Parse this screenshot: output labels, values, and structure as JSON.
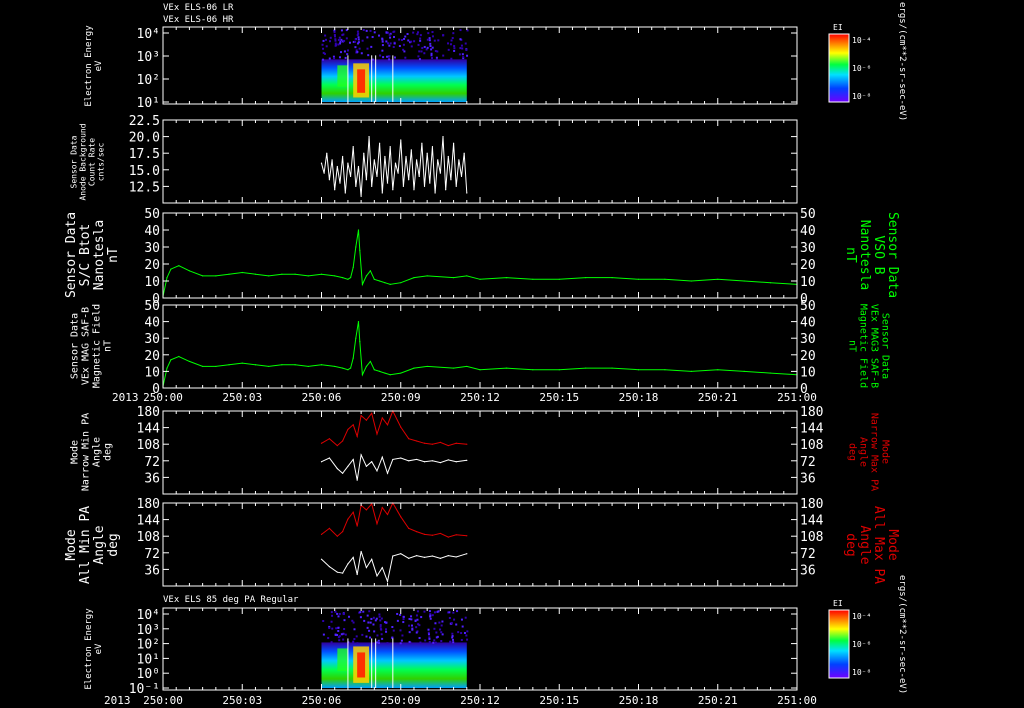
{
  "header": {
    "line1": "VEx ELS-06 LR",
    "line2": "VEx ELS-06 HR",
    "panel7_title": "VEx ELS 85 deg PA Regular"
  },
  "units_right": "ergs/(cm**2-sr-sec-eV)",
  "colorbar": {
    "label": "EI",
    "ticks": [
      "10⁻⁴",
      "10⁻⁶",
      "10⁻⁸"
    ]
  },
  "time_axis": {
    "year": "2013",
    "ticks": [
      "250:00",
      "250:03",
      "250:06",
      "250:09",
      "250:12",
      "250:15",
      "250:18",
      "250:21",
      "251:00"
    ]
  },
  "chart_data": [
    {
      "id": "p1",
      "type": "heatmap",
      "ylabel": [
        "Electron Energy",
        "eV"
      ],
      "yticks": [
        "10⁴",
        "10³",
        "10²",
        "10¹"
      ],
      "x_range": [
        "250:06",
        "250:11"
      ]
    },
    {
      "id": "p2",
      "type": "line",
      "ylabel": [
        "Sensor Data",
        "Anode Background",
        "Count Rate",
        "cnts/sec"
      ],
      "yticks": [
        "22.5",
        "20.0",
        "17.5",
        "15.0",
        "12.5"
      ],
      "ylim": [
        10,
        22.5
      ],
      "series": [
        {
          "color": "#ffffff",
          "x": [
            6.0,
            6.1,
            6.2,
            6.3,
            6.4,
            6.5,
            6.6,
            6.7,
            6.8,
            6.9,
            7.0,
            7.1,
            7.2,
            7.3,
            7.4,
            7.5,
            7.6,
            7.7,
            7.8,
            7.9,
            8.0,
            8.1,
            8.2,
            8.3,
            8.4,
            8.5,
            8.6,
            8.7,
            8.8,
            8.9,
            9.0,
            9.1,
            9.2,
            9.3,
            9.4,
            9.5,
            9.6,
            9.7,
            9.8,
            9.9,
            10.0,
            10.1,
            10.2,
            10.3,
            10.4,
            10.5,
            10.6,
            10.7,
            10.8,
            10.9,
            11.0,
            11.1,
            11.2,
            11.3,
            11.4,
            11.5
          ],
          "y": [
            16.0,
            14.5,
            17.5,
            13.5,
            16.5,
            12.0,
            15.5,
            13.0,
            17.0,
            11.5,
            16.0,
            14.0,
            18.5,
            12.5,
            15.5,
            11.0,
            17.5,
            13.5,
            20.0,
            12.5,
            16.5,
            14.0,
            19.0,
            11.5,
            17.0,
            13.0,
            18.5,
            12.0,
            16.0,
            14.5,
            19.5,
            12.5,
            17.0,
            13.5,
            18.0,
            12.0,
            16.5,
            14.0,
            19.0,
            12.5,
            17.5,
            13.0,
            18.5,
            11.5,
            16.5,
            14.5,
            20.0,
            12.0,
            17.0,
            13.5,
            19.0,
            12.5,
            16.5,
            14.0,
            17.5,
            11.5
          ]
        }
      ]
    },
    {
      "id": "p3",
      "type": "line",
      "ylabel": [
        "Sensor Data",
        "S/C Btot",
        "Nanotesla",
        "nT"
      ],
      "ylabel_right": [
        "Sensor Data",
        "VSO B",
        "Nanotesla",
        "nT"
      ],
      "yticks": [
        "50",
        "40",
        "30",
        "20",
        "10",
        "0"
      ],
      "ylim": [
        0,
        50
      ],
      "series": [
        {
          "color": "#00ff00",
          "x": [
            0.0,
            0.15,
            0.3,
            0.6,
            1.0,
            1.5,
            2.0,
            2.5,
            3.0,
            3.5,
            4.0,
            4.5,
            5.0,
            5.5,
            6.0,
            6.5,
            6.8,
            7.0,
            7.1,
            7.2,
            7.3,
            7.4,
            7.45,
            7.55,
            7.7,
            7.85,
            8.0,
            8.2,
            8.4,
            8.6,
            9.0,
            9.5,
            10.0,
            11.0,
            11.5,
            12.0,
            13.0,
            14.0,
            15.0,
            16.0,
            17.0,
            18.0,
            19.0,
            20.0,
            21.0,
            22.0,
            23.0,
            24.0
          ],
          "y": [
            1,
            12,
            17,
            19,
            16,
            13,
            13,
            14,
            15,
            14,
            13,
            14,
            14,
            13,
            14,
            13,
            12,
            11,
            12,
            18,
            30,
            40,
            28,
            8,
            13,
            16,
            11,
            10,
            9,
            8,
            9,
            12,
            13,
            12,
            13,
            11,
            12,
            11,
            11,
            12,
            12,
            11,
            11,
            10,
            11,
            10,
            9,
            8
          ]
        }
      ]
    },
    {
      "id": "p4",
      "type": "line",
      "ylabel": [
        "Sensor Data",
        "VEx MAG SAF-B",
        "Magnetic Field",
        "nT"
      ],
      "ylabel_right": [
        "Sensor Data",
        "VEx MAG3 SAF-B",
        "Magnetic Field",
        "nT"
      ],
      "yticks": [
        "50",
        "40",
        "30",
        "20",
        "10",
        "0"
      ],
      "ylim": [
        0,
        50
      ],
      "series": [
        {
          "color": "#00ff00",
          "x": [
            0.0,
            0.15,
            0.3,
            0.6,
            1.0,
            1.5,
            2.0,
            2.5,
            3.0,
            3.5,
            4.0,
            4.5,
            5.0,
            5.5,
            6.0,
            6.5,
            6.8,
            7.0,
            7.1,
            7.2,
            7.3,
            7.4,
            7.45,
            7.55,
            7.7,
            7.85,
            8.0,
            8.2,
            8.4,
            8.6,
            9.0,
            9.5,
            10.0,
            11.0,
            11.5,
            12.0,
            13.0,
            14.0,
            15.0,
            16.0,
            17.0,
            18.0,
            19.0,
            20.0,
            21.0,
            22.0,
            23.0,
            24.0
          ],
          "y": [
            1,
            12,
            17,
            19,
            16,
            13,
            13,
            14,
            15,
            14,
            13,
            14,
            14,
            13,
            14,
            13,
            12,
            11,
            12,
            18,
            30,
            40,
            28,
            8,
            13,
            16,
            11,
            10,
            9,
            8,
            9,
            12,
            13,
            12,
            13,
            11,
            12,
            11,
            11,
            12,
            12,
            11,
            11,
            10,
            11,
            10,
            9,
            8
          ]
        }
      ]
    },
    {
      "id": "p5",
      "type": "line",
      "ylabel": [
        "Mode",
        "Narrow Min PA",
        "Angle",
        "deg"
      ],
      "ylabel_right": [
        "Mode",
        "Narrow Max PA",
        "Angle",
        "deg"
      ],
      "yticks": [
        "180",
        "144",
        "108",
        "72",
        "36"
      ],
      "ylim": [
        0,
        180
      ],
      "series": [
        {
          "color": "#dd0000",
          "x": [
            6.0,
            6.3,
            6.6,
            6.8,
            7.0,
            7.2,
            7.35,
            7.5,
            7.7,
            7.9,
            8.1,
            8.3,
            8.5,
            8.7,
            9.0,
            9.3,
            9.6,
            9.9,
            10.2,
            10.5,
            10.8,
            11.1,
            11.5
          ],
          "y": [
            110,
            120,
            105,
            115,
            140,
            150,
            125,
            170,
            160,
            175,
            130,
            165,
            150,
            180,
            145,
            120,
            115,
            110,
            108,
            112,
            105,
            110,
            108
          ]
        },
        {
          "color": "#ffffff",
          "x": [
            6.0,
            6.3,
            6.6,
            6.8,
            7.0,
            7.2,
            7.35,
            7.5,
            7.7,
            7.9,
            8.1,
            8.3,
            8.5,
            8.7,
            9.0,
            9.3,
            9.6,
            9.9,
            10.2,
            10.5,
            10.8,
            11.1,
            11.5
          ],
          "y": [
            70,
            78,
            55,
            45,
            60,
            75,
            30,
            85,
            60,
            70,
            50,
            80,
            45,
            75,
            78,
            72,
            75,
            70,
            72,
            68,
            74,
            70,
            73
          ]
        }
      ]
    },
    {
      "id": "p6",
      "type": "line",
      "ylabel": [
        "Mode",
        "All Min PA",
        "Angle",
        "deg"
      ],
      "ylabel_right": [
        "Mode",
        "All Max PA",
        "Angle",
        "deg"
      ],
      "yticks": [
        "180",
        "144",
        "108",
        "72",
        "36"
      ],
      "ylim": [
        0,
        180
      ],
      "series": [
        {
          "color": "#dd0000",
          "x": [
            6.0,
            6.3,
            6.6,
            6.8,
            7.0,
            7.2,
            7.35,
            7.5,
            7.7,
            7.9,
            8.1,
            8.3,
            8.5,
            8.7,
            9.0,
            9.3,
            9.6,
            9.9,
            10.2,
            10.5,
            10.8,
            11.1,
            11.5
          ],
          "y": [
            112,
            125,
            108,
            118,
            145,
            160,
            130,
            175,
            165,
            178,
            135,
            170,
            155,
            180,
            150,
            125,
            118,
            112,
            110,
            114,
            106,
            111,
            109
          ]
        },
        {
          "color": "#ffffff",
          "x": [
            6.0,
            6.3,
            6.6,
            6.8,
            7.0,
            7.2,
            7.35,
            7.5,
            7.7,
            7.9,
            8.1,
            8.3,
            8.5,
            8.7,
            9.0,
            9.3,
            9.6,
            9.9,
            10.2,
            10.5,
            10.8,
            11.1,
            11.5
          ],
          "y": [
            58,
            42,
            30,
            28,
            48,
            62,
            25,
            75,
            40,
            58,
            22,
            40,
            10,
            65,
            70,
            60,
            66,
            62,
            65,
            60,
            66,
            63,
            70
          ]
        }
      ]
    },
    {
      "id": "p7",
      "type": "heatmap",
      "ylabel": [
        "Electron Energy",
        "eV"
      ],
      "yticks": [
        "10⁴",
        "10³",
        "10²",
        "10¹",
        "10⁰",
        "10⁻¹"
      ],
      "x_range": [
        "250:06",
        "250:11"
      ]
    }
  ]
}
